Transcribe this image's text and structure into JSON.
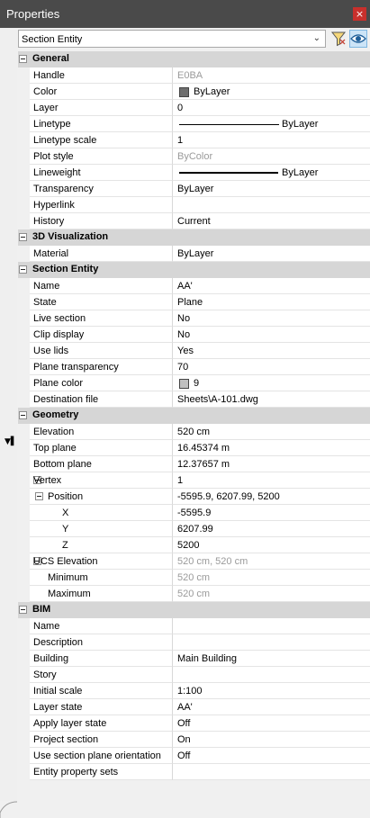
{
  "panel": {
    "title": "Properties",
    "close_glyph": "×"
  },
  "selector": {
    "value": "Section Entity",
    "chevron": "⌄"
  },
  "groups": [
    {
      "title": "General",
      "rows": [
        {
          "name": "Handle",
          "value": "E0BA",
          "grey": true
        },
        {
          "name": "Color",
          "value": "ByLayer",
          "swatch": "#6e6e6e"
        },
        {
          "name": "Layer",
          "value": "0"
        },
        {
          "name": "Linetype",
          "value": "ByLayer",
          "line": "thin"
        },
        {
          "name": "Linetype scale",
          "value": "1"
        },
        {
          "name": "Plot style",
          "value": "ByColor",
          "grey": true
        },
        {
          "name": "Lineweight",
          "value": "ByLayer",
          "line": "thick"
        },
        {
          "name": "Transparency",
          "value": "ByLayer"
        },
        {
          "name": "Hyperlink",
          "value": ""
        },
        {
          "name": "History",
          "value": "Current"
        }
      ]
    },
    {
      "title": "3D Visualization",
      "rows": [
        {
          "name": "Material",
          "value": "ByLayer"
        }
      ]
    },
    {
      "title": "Section Entity",
      "rows": [
        {
          "name": "Name",
          "value": "AA'"
        },
        {
          "name": "State",
          "value": "Plane"
        },
        {
          "name": "Live section",
          "value": "No"
        },
        {
          "name": "Clip display",
          "value": "No"
        },
        {
          "name": "Use lids",
          "value": "Yes"
        },
        {
          "name": "Plane transparency",
          "value": "70"
        },
        {
          "name": "Plane color",
          "value": "9",
          "swatch": "#c0c0c0"
        },
        {
          "name": "Destination file",
          "value": "Sheets\\A-101.dwg"
        }
      ]
    },
    {
      "title": "Geometry",
      "rows": [
        {
          "name": "Elevation",
          "value": "520 cm"
        },
        {
          "name": "Top plane",
          "value": "16.45374 m"
        },
        {
          "name": "Bottom plane",
          "value": "12.37657 m"
        },
        {
          "name": "Vertex",
          "value": "1",
          "expander": true
        },
        {
          "name": "Position",
          "value": "-5595.9, 6207.99, 5200",
          "expander": true,
          "level": 1
        },
        {
          "name": "X",
          "value": "-5595.9",
          "level": 2
        },
        {
          "name": "Y",
          "value": "6207.99",
          "level": 2
        },
        {
          "name": "Z",
          "value": "5200",
          "level": 2
        },
        {
          "name": "UCS Elevation",
          "value": "520 cm, 520 cm",
          "grey": true,
          "expander": true
        },
        {
          "name": "Minimum",
          "value": "520 cm",
          "grey": true,
          "level": 1
        },
        {
          "name": "Maximum",
          "value": "520 cm",
          "grey": true,
          "level": 1
        }
      ]
    },
    {
      "title": "BIM",
      "rows": [
        {
          "name": "Name",
          "value": ""
        },
        {
          "name": "Description",
          "value": ""
        },
        {
          "name": "Building",
          "value": "Main Building"
        },
        {
          "name": "Story",
          "value": ""
        },
        {
          "name": "Initial scale",
          "value": "1:100"
        },
        {
          "name": "Layer state",
          "value": "AA'"
        },
        {
          "name": "Apply layer state",
          "value": "Off"
        },
        {
          "name": "Project section",
          "value": "On"
        },
        {
          "name": "Use section plane orientation",
          "value": "Off"
        },
        {
          "name": "Entity property sets",
          "value": ""
        }
      ]
    }
  ]
}
